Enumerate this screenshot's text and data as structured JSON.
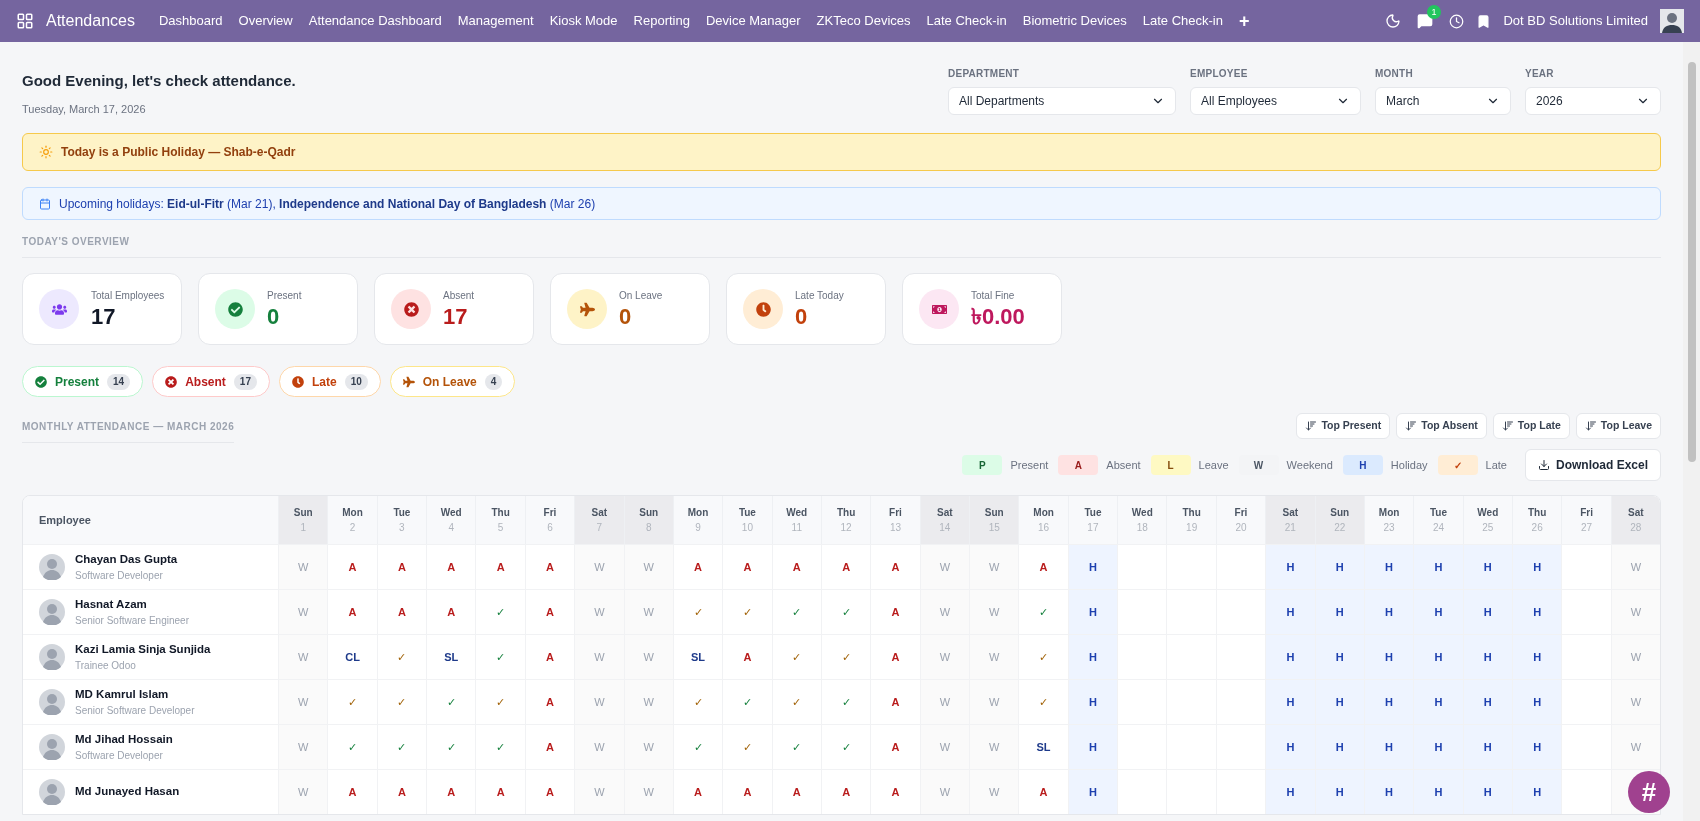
{
  "navbar": {
    "app_title": "Attendances",
    "menu": [
      "Dashboard",
      "Overview",
      "Attendance Dashboard",
      "Management",
      "Kiosk Mode",
      "Reporting",
      "Device Manager",
      "ZKTeco Devices",
      "Late Check-in",
      "Biometric Devices",
      "Late Check-in"
    ],
    "add_symbol": "+",
    "chat_badge": "1",
    "company": "Dot BD Solutions Limited"
  },
  "header": {
    "greeting": "Good Evening, let's check attendance.",
    "date": "Tuesday, March 17, 2026"
  },
  "filters": [
    {
      "label": "DEPARTMENT",
      "value": "All Departments"
    },
    {
      "label": "EMPLOYEE",
      "value": "All Employees"
    },
    {
      "label": "MONTH",
      "value": "March"
    },
    {
      "label": "YEAR",
      "value": "2026"
    }
  ],
  "holiday_banner": "Today is a Public Holiday — Shab-e-Qadr",
  "upcoming_banner": "Upcoming holidays: **Eid-ul-Fitr** (Mar 21), **Independence and National Day of Bangladesh** (Mar 26)",
  "overview_title": "TODAY'S OVERVIEW",
  "stats": [
    {
      "kind": "employees",
      "label": "Total Employees",
      "value": "17",
      "color": "#7c3aed"
    },
    {
      "kind": "present",
      "label": "Present",
      "value": "0",
      "color": "#15803d"
    },
    {
      "kind": "absent",
      "label": "Absent",
      "value": "17",
      "color": "#b91c1c"
    },
    {
      "kind": "leave",
      "label": "On Leave",
      "value": "0",
      "color": "#b45309"
    },
    {
      "kind": "late",
      "label": "Late Today",
      "value": "0",
      "color": "#c2410c"
    },
    {
      "kind": "fine",
      "label": "Total Fine",
      "value": "৳0.00",
      "color": "#be185d"
    }
  ],
  "chips": [
    {
      "kind": "present",
      "label": "Present",
      "count": "14"
    },
    {
      "kind": "absent",
      "label": "Absent",
      "count": "17"
    },
    {
      "kind": "late",
      "label": "Late",
      "count": "10"
    },
    {
      "kind": "leave",
      "label": "On Leave",
      "count": "4"
    }
  ],
  "monthly_title": "MONTHLY ATTENDANCE — MARCH 2026",
  "sort_buttons": [
    "Top Present",
    "Top Absent",
    "Top Late",
    "Top Leave"
  ],
  "legend": [
    {
      "kind": "present",
      "mark": "P",
      "label": "Present"
    },
    {
      "kind": "absent",
      "mark": "A",
      "label": "Absent"
    },
    {
      "kind": "leave",
      "mark": "L",
      "label": "Leave"
    },
    {
      "kind": "weekend",
      "mark": "W",
      "label": "Weekend"
    },
    {
      "kind": "holiday",
      "mark": "H",
      "label": "Holiday"
    },
    {
      "kind": "late",
      "mark": "✓",
      "label": "Late"
    }
  ],
  "download_button": "Download Excel",
  "table": {
    "employee_header": "Employee",
    "days": [
      {
        "dow": "Sun",
        "day": "1",
        "weekend": true
      },
      {
        "dow": "Mon",
        "day": "2",
        "weekend": false
      },
      {
        "dow": "Tue",
        "day": "3",
        "weekend": false
      },
      {
        "dow": "Wed",
        "day": "4",
        "weekend": false
      },
      {
        "dow": "Thu",
        "day": "5",
        "weekend": false
      },
      {
        "dow": "Fri",
        "day": "6",
        "weekend": false
      },
      {
        "dow": "Sat",
        "day": "7",
        "weekend": true
      },
      {
        "dow": "Sun",
        "day": "8",
        "weekend": true
      },
      {
        "dow": "Mon",
        "day": "9",
        "weekend": false
      },
      {
        "dow": "Tue",
        "day": "10",
        "weekend": false
      },
      {
        "dow": "Wed",
        "day": "11",
        "weekend": false
      },
      {
        "dow": "Thu",
        "day": "12",
        "weekend": false
      },
      {
        "dow": "Fri",
        "day": "13",
        "weekend": false
      },
      {
        "dow": "Sat",
        "day": "14",
        "weekend": true
      },
      {
        "dow": "Sun",
        "day": "15",
        "weekend": true
      },
      {
        "dow": "Mon",
        "day": "16",
        "weekend": false
      },
      {
        "dow": "Tue",
        "day": "17",
        "weekend": false
      },
      {
        "dow": "Wed",
        "day": "18",
        "weekend": false
      },
      {
        "dow": "Thu",
        "day": "19",
        "weekend": false
      },
      {
        "dow": "Fri",
        "day": "20",
        "weekend": false
      },
      {
        "dow": "Sat",
        "day": "21",
        "weekend": true
      },
      {
        "dow": "Sun",
        "day": "22",
        "weekend": true
      },
      {
        "dow": "Mon",
        "day": "23",
        "weekend": false
      },
      {
        "dow": "Tue",
        "day": "24",
        "weekend": false
      },
      {
        "dow": "Wed",
        "day": "25",
        "weekend": false
      },
      {
        "dow": "Thu",
        "day": "26",
        "weekend": false
      },
      {
        "dow": "Fri",
        "day": "27",
        "weekend": false
      },
      {
        "dow": "Sat",
        "day": "28",
        "weekend": true
      }
    ],
    "rows": [
      {
        "name": "Chayan Das Gupta",
        "title": "Software Developer",
        "cells": [
          {
            "kind": "weekend",
            "text": "W"
          },
          {
            "kind": "absent",
            "text": "A"
          },
          {
            "kind": "absent",
            "text": "A"
          },
          {
            "kind": "absent",
            "text": "A"
          },
          {
            "kind": "absent",
            "text": "A"
          },
          {
            "kind": "absent",
            "text": "A"
          },
          {
            "kind": "weekend",
            "text": "W"
          },
          {
            "kind": "weekend",
            "text": "W"
          },
          {
            "kind": "absent",
            "text": "A"
          },
          {
            "kind": "absent",
            "text": "A"
          },
          {
            "kind": "absent",
            "text": "A"
          },
          {
            "kind": "absent",
            "text": "A"
          },
          {
            "kind": "absent",
            "text": "A"
          },
          {
            "kind": "weekend",
            "text": "W"
          },
          {
            "kind": "weekend",
            "text": "W"
          },
          {
            "kind": "absent",
            "text": "A"
          },
          {
            "kind": "holiday",
            "text": "H"
          },
          {
            "kind": "empty"
          },
          {
            "kind": "empty"
          },
          {
            "kind": "empty"
          },
          {
            "kind": "holiday",
            "text": "H"
          },
          {
            "kind": "holiday",
            "text": "H"
          },
          {
            "kind": "holiday",
            "text": "H"
          },
          {
            "kind": "holiday",
            "text": "H"
          },
          {
            "kind": "holiday",
            "text": "H"
          },
          {
            "kind": "holiday",
            "text": "H"
          },
          {
            "kind": "empty"
          },
          {
            "kind": "weekend",
            "text": "W"
          }
        ]
      },
      {
        "name": "Hasnat Azam",
        "title": "Senior Software Engineer",
        "cells": [
          {
            "kind": "weekend",
            "text": "W"
          },
          {
            "kind": "absent",
            "text": "A"
          },
          {
            "kind": "absent",
            "text": "A"
          },
          {
            "kind": "absent",
            "text": "A"
          },
          {
            "kind": "present",
            "text": "✓"
          },
          {
            "kind": "absent",
            "text": "A"
          },
          {
            "kind": "weekend",
            "text": "W"
          },
          {
            "kind": "weekend",
            "text": "W"
          },
          {
            "kind": "late",
            "text": "✓"
          },
          {
            "kind": "late",
            "text": "✓"
          },
          {
            "kind": "present",
            "text": "✓"
          },
          {
            "kind": "present",
            "text": "✓"
          },
          {
            "kind": "absent",
            "text": "A"
          },
          {
            "kind": "weekend",
            "text": "W"
          },
          {
            "kind": "weekend",
            "text": "W"
          },
          {
            "kind": "present",
            "text": "✓"
          },
          {
            "kind": "holiday",
            "text": "H"
          },
          {
            "kind": "empty"
          },
          {
            "kind": "empty"
          },
          {
            "kind": "empty"
          },
          {
            "kind": "holiday",
            "text": "H"
          },
          {
            "kind": "holiday",
            "text": "H"
          },
          {
            "kind": "holiday",
            "text": "H"
          },
          {
            "kind": "holiday",
            "text": "H"
          },
          {
            "kind": "holiday",
            "text": "H"
          },
          {
            "kind": "holiday",
            "text": "H"
          },
          {
            "kind": "empty"
          },
          {
            "kind": "weekend",
            "text": "W"
          }
        ]
      },
      {
        "name": "Kazi Lamia Sinja Sunjida",
        "title": "Trainee Odoo",
        "cells": [
          {
            "kind": "weekend",
            "text": "W"
          },
          {
            "kind": "leave",
            "text": "CL"
          },
          {
            "kind": "late",
            "text": "✓"
          },
          {
            "kind": "leave",
            "text": "SL"
          },
          {
            "kind": "present",
            "text": "✓"
          },
          {
            "kind": "absent",
            "text": "A"
          },
          {
            "kind": "weekend",
            "text": "W"
          },
          {
            "kind": "weekend",
            "text": "W"
          },
          {
            "kind": "leave",
            "text": "SL"
          },
          {
            "kind": "absent",
            "text": "A"
          },
          {
            "kind": "late",
            "text": "✓"
          },
          {
            "kind": "late",
            "text": "✓"
          },
          {
            "kind": "absent",
            "text": "A"
          },
          {
            "kind": "weekend",
            "text": "W"
          },
          {
            "kind": "weekend",
            "text": "W"
          },
          {
            "kind": "late",
            "text": "✓"
          },
          {
            "kind": "holiday",
            "text": "H"
          },
          {
            "kind": "empty"
          },
          {
            "kind": "empty"
          },
          {
            "kind": "empty"
          },
          {
            "kind": "holiday",
            "text": "H"
          },
          {
            "kind": "holiday",
            "text": "H"
          },
          {
            "kind": "holiday",
            "text": "H"
          },
          {
            "kind": "holiday",
            "text": "H"
          },
          {
            "kind": "holiday",
            "text": "H"
          },
          {
            "kind": "holiday",
            "text": "H"
          },
          {
            "kind": "empty"
          },
          {
            "kind": "weekend",
            "text": "W"
          }
        ]
      },
      {
        "name": "MD Kamrul Islam",
        "title": "Senior Software Developer",
        "cells": [
          {
            "kind": "weekend",
            "text": "W"
          },
          {
            "kind": "late",
            "text": "✓"
          },
          {
            "kind": "late",
            "text": "✓"
          },
          {
            "kind": "present",
            "text": "✓"
          },
          {
            "kind": "late",
            "text": "✓"
          },
          {
            "kind": "absent",
            "text": "A"
          },
          {
            "kind": "weekend",
            "text": "W"
          },
          {
            "kind": "weekend",
            "text": "W"
          },
          {
            "kind": "late",
            "text": "✓"
          },
          {
            "kind": "present",
            "text": "✓"
          },
          {
            "kind": "late",
            "text": "✓"
          },
          {
            "kind": "present",
            "text": "✓"
          },
          {
            "kind": "absent",
            "text": "A"
          },
          {
            "kind": "weekend",
            "text": "W"
          },
          {
            "kind": "weekend",
            "text": "W"
          },
          {
            "kind": "late",
            "text": "✓"
          },
          {
            "kind": "holiday",
            "text": "H"
          },
          {
            "kind": "empty"
          },
          {
            "kind": "empty"
          },
          {
            "kind": "empty"
          },
          {
            "kind": "holiday",
            "text": "H"
          },
          {
            "kind": "holiday",
            "text": "H"
          },
          {
            "kind": "holiday",
            "text": "H"
          },
          {
            "kind": "holiday",
            "text": "H"
          },
          {
            "kind": "holiday",
            "text": "H"
          },
          {
            "kind": "holiday",
            "text": "H"
          },
          {
            "kind": "empty"
          },
          {
            "kind": "weekend",
            "text": "W"
          }
        ]
      },
      {
        "name": "Md Jihad Hossain",
        "title": "Software Developer",
        "cells": [
          {
            "kind": "weekend",
            "text": "W"
          },
          {
            "kind": "present",
            "text": "✓"
          },
          {
            "kind": "present",
            "text": "✓"
          },
          {
            "kind": "present",
            "text": "✓"
          },
          {
            "kind": "present",
            "text": "✓"
          },
          {
            "kind": "absent",
            "text": "A"
          },
          {
            "kind": "weekend",
            "text": "W"
          },
          {
            "kind": "weekend",
            "text": "W"
          },
          {
            "kind": "present",
            "text": "✓"
          },
          {
            "kind": "late",
            "text": "✓"
          },
          {
            "kind": "present",
            "text": "✓"
          },
          {
            "kind": "present",
            "text": "✓"
          },
          {
            "kind": "absent",
            "text": "A"
          },
          {
            "kind": "weekend",
            "text": "W"
          },
          {
            "kind": "weekend",
            "text": "W"
          },
          {
            "kind": "leave",
            "text": "SL"
          },
          {
            "kind": "holiday",
            "text": "H"
          },
          {
            "kind": "empty"
          },
          {
            "kind": "empty"
          },
          {
            "kind": "empty"
          },
          {
            "kind": "holiday",
            "text": "H"
          },
          {
            "kind": "holiday",
            "text": "H"
          },
          {
            "kind": "holiday",
            "text": "H"
          },
          {
            "kind": "holiday",
            "text": "H"
          },
          {
            "kind": "holiday",
            "text": "H"
          },
          {
            "kind": "holiday",
            "text": "H"
          },
          {
            "kind": "empty"
          },
          {
            "kind": "weekend",
            "text": "W"
          }
        ]
      },
      {
        "name": "Md Junayed Hasan",
        "cells": [
          {
            "kind": "weekend",
            "text": "W"
          },
          {
            "kind": "absent",
            "text": "A"
          },
          {
            "kind": "absent",
            "text": "A"
          },
          {
            "kind": "absent",
            "text": "A"
          },
          {
            "kind": "absent",
            "text": "A"
          },
          {
            "kind": "absent",
            "text": "A"
          },
          {
            "kind": "weekend",
            "text": "W"
          },
          {
            "kind": "weekend",
            "text": "W"
          },
          {
            "kind": "absent",
            "text": "A"
          },
          {
            "kind": "absent",
            "text": "A"
          },
          {
            "kind": "absent",
            "text": "A"
          },
          {
            "kind": "absent",
            "text": "A"
          },
          {
            "kind": "absent",
            "text": "A"
          },
          {
            "kind": "weekend",
            "text": "W"
          },
          {
            "kind": "weekend",
            "text": "W"
          },
          {
            "kind": "absent",
            "text": "A"
          },
          {
            "kind": "holiday",
            "text": "H"
          },
          {
            "kind": "empty"
          },
          {
            "kind": "empty"
          },
          {
            "kind": "empty"
          },
          {
            "kind": "holiday",
            "text": "H"
          },
          {
            "kind": "holiday",
            "text": "H"
          },
          {
            "kind": "holiday",
            "text": "H"
          },
          {
            "kind": "holiday",
            "text": "H"
          },
          {
            "kind": "holiday",
            "text": "H"
          },
          {
            "kind": "holiday",
            "text": "H"
          },
          {
            "kind": "empty"
          },
          {
            "kind": "weekend"
          }
        ]
      }
    ]
  },
  "fab_symbol": "#"
}
